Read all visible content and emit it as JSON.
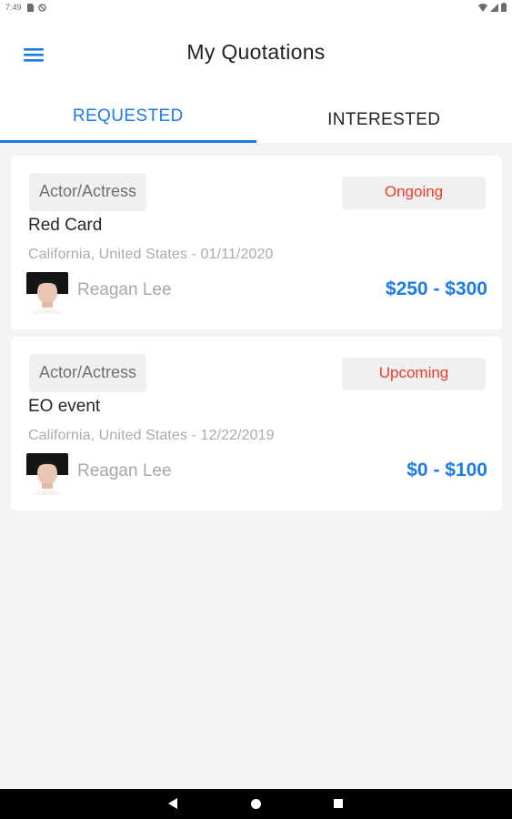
{
  "status_bar": {
    "time": "7:49"
  },
  "header": {
    "title": "My Quotations"
  },
  "tabs": [
    {
      "label": "REQUESTED",
      "active": true
    },
    {
      "label": "INTERESTED",
      "active": false
    }
  ],
  "quotations": [
    {
      "category": "Actor/Actress",
      "status": "Ongoing",
      "event": "Red Card",
      "location_date": "California, United States - 01/11/2020",
      "person": "Reagan Lee",
      "price": "$250 - $300"
    },
    {
      "category": "Actor/Actress",
      "status": "Upcoming",
      "event": "EO event",
      "location_date": "California, United States - 12/22/2019",
      "person": "Reagan Lee",
      "price": "$0 - $100"
    }
  ],
  "colors": {
    "accent": "#1d7be6",
    "status_red": "#f0392b",
    "background": "#f4f4f5"
  },
  "icons": {
    "menu": "hamburger-menu-icon",
    "back": "nav-back-icon",
    "home": "nav-home-icon",
    "recents": "nav-recents-icon"
  }
}
